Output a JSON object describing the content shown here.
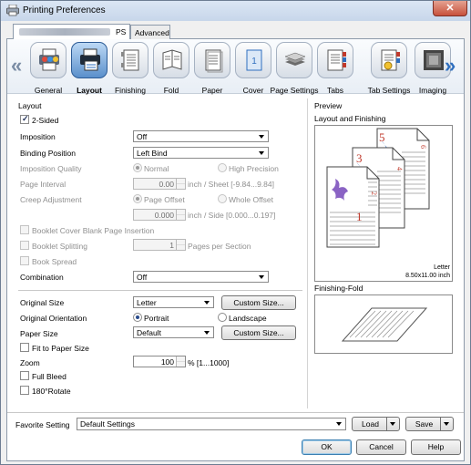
{
  "window": {
    "title": "Printing Preferences",
    "close_label": "✕"
  },
  "tabs": {
    "printer_tab_label": "PS",
    "advanced_tab_label": "Advanced"
  },
  "features": [
    {
      "label": "General",
      "icon": "general-icon"
    },
    {
      "label": "Layout",
      "icon": "layout-icon",
      "selected": true
    },
    {
      "label": "Finishing",
      "icon": "finishing-icon"
    },
    {
      "label": "Fold",
      "icon": "fold-icon"
    },
    {
      "label": "Paper",
      "icon": "paper-icon"
    },
    {
      "label": "Cover",
      "icon": "cover-icon"
    },
    {
      "label": "Page Settings",
      "icon": "page-settings-icon"
    },
    {
      "label": "Tabs",
      "icon": "tabs-icon"
    },
    {
      "label": "Tab Settings",
      "icon": "tab-settings-icon"
    },
    {
      "label": "Imaging",
      "icon": "imaging-icon"
    }
  ],
  "nav": {
    "left": "«",
    "right": "»"
  },
  "layout": {
    "group_label": "Layout",
    "two_sided_label": "2-Sided",
    "two_sided_checked": true,
    "imposition_label": "Imposition",
    "imposition_value": "Off",
    "binding_position_label": "Binding Position",
    "binding_position_value": "Left Bind",
    "imposition_quality_label": "Imposition Quality",
    "quality_normal": "Normal",
    "quality_high": "High Precision",
    "page_interval_label": "Page Interval",
    "page_interval_value": "0.00",
    "page_interval_unit": "inch / Sheet [-9.84...9.84]",
    "creep_label": "Creep Adjustment",
    "creep_page_offset": "Page Offset",
    "creep_whole_offset": "Whole Offset",
    "creep_value": "0.000",
    "creep_unit": "inch / Side [0.000...0.197]",
    "booklet_cover_label": "Booklet Cover Blank Page Insertion",
    "booklet_split_label": "Booklet Splitting",
    "booklet_split_value": "1",
    "booklet_split_unit": "Pages per Section",
    "book_spread_label": "Book Spread",
    "combination_label": "Combination",
    "combination_value": "Off",
    "original_size_label": "Original Size",
    "original_size_value": "Letter",
    "custom_size_label": "Custom Size...",
    "original_orientation_label": "Original Orientation",
    "portrait_label": "Portrait",
    "landscape_label": "Landscape",
    "paper_size_label": "Paper Size",
    "paper_size_value": "Default",
    "custom_size2_label": "Custom Size...",
    "fit_to_paper_label": "Fit to Paper Size",
    "zoom_label": "Zoom",
    "zoom_value": "100",
    "zoom_unit": "% [1...1000]",
    "full_bleed_label": "Full Bleed",
    "rotate_label": "180°Rotate"
  },
  "preview": {
    "group_label": "Preview",
    "layout_finishing_label": "Layout and Finishing",
    "paper_name": "Letter",
    "paper_dims": "8.50x11.00 inch",
    "page_numbers": [
      "1",
      "2",
      "3",
      "4",
      "5",
      "6"
    ],
    "finishing_fold_label": "Finishing-Fold"
  },
  "bottom": {
    "favorite_label": "Favorite Setting",
    "favorite_value": "Default Settings",
    "load_label": "Load",
    "save_label": "Save",
    "ok_label": "OK",
    "cancel_label": "Cancel",
    "help_label": "Help"
  },
  "colors": {
    "accent": "#2f6fbf",
    "page_number": "#c0392b",
    "selected_button": "#5a8fcb"
  }
}
